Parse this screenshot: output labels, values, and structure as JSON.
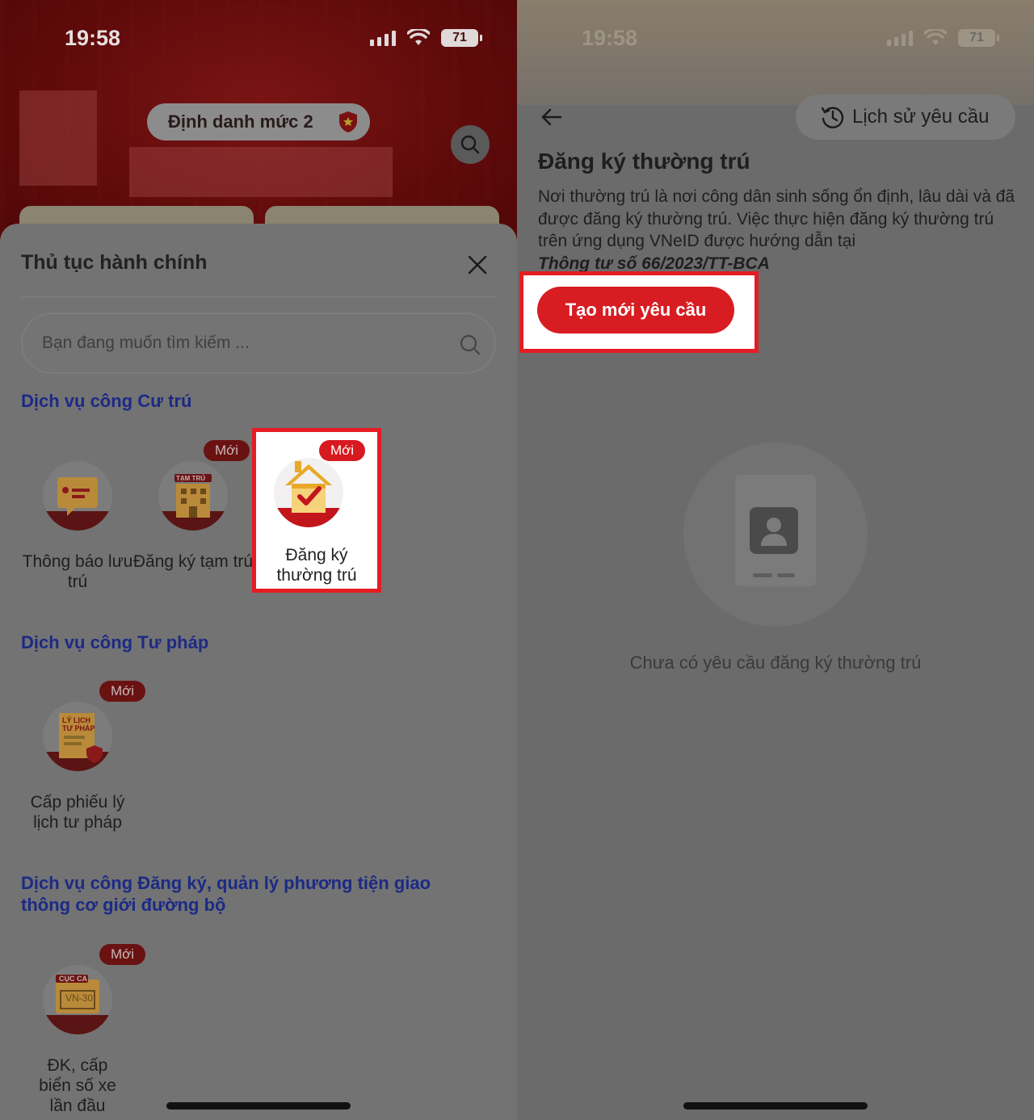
{
  "left": {
    "status": {
      "time": "19:58",
      "battery": "71"
    },
    "header": {
      "level_label": "Định danh mức 2"
    },
    "sheet": {
      "title": "Thủ tục hành chính",
      "search_placeholder": "Bạn đang muốn tìm kiếm ...",
      "sections": [
        {
          "title": "Dịch vụ công Cư trú",
          "items": [
            {
              "label": "Thông báo lưu trú",
              "badge": ""
            },
            {
              "label": "Đăng ký tạm trú",
              "badge": "Mới",
              "icon_text": "TẠM TRÚ"
            },
            {
              "label": "Đăng ký thường trú",
              "badge": "Mới",
              "highlighted": true
            }
          ]
        },
        {
          "title": "Dịch vụ công Tư pháp",
          "items": [
            {
              "label": "Cấp phiếu lý lịch tư pháp",
              "badge": "Mới",
              "icon_text": "LÝ LỊCH TƯ PHÁP"
            }
          ]
        },
        {
          "title": "Dịch vụ công Đăng ký, quản lý phương tiện giao thông cơ giới đường bộ",
          "items": [
            {
              "label": "ĐK, cấp biển số xe lần đầu",
              "badge": "Mới",
              "icon_text": "CỤC CA",
              "plate": "VN-30"
            }
          ]
        }
      ]
    }
  },
  "right": {
    "status": {
      "time": "19:58",
      "battery": "71"
    },
    "history_button": "Lịch sử yêu cầu",
    "page_title": "Đăng ký thường trú",
    "description": "Nơi thường trú là nơi công dân sinh sống ổn định, lâu dài và đã được đăng ký thường trú. Việc thực hiện đăng ký thường trú trên ứng dụng VNeID được hướng dẫn tại",
    "law_reference": "Thông tư số 66/2023/TT-BCA",
    "create_button": "Tạo mới yêu cầu",
    "empty_text": "Chưa có yêu cầu đăng ký thường trú"
  },
  "colors": {
    "accent_red": "#d81d22",
    "section_blue": "#1c2a86",
    "highlight_outline": "#e51c23"
  }
}
